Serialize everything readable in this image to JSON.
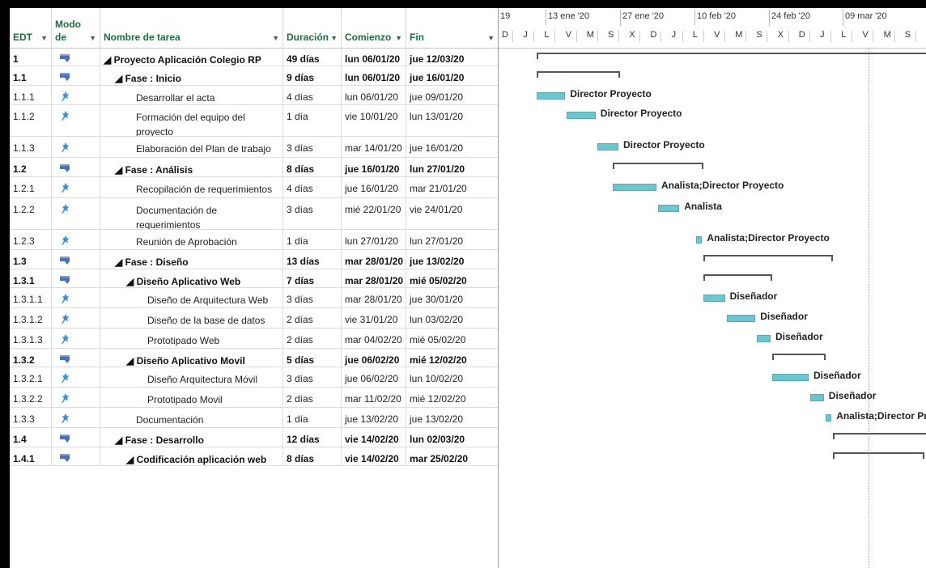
{
  "columns": {
    "edt": "EDT",
    "modo_top": "Modo",
    "modo_bottom": "de",
    "name": "Nombre de tarea",
    "duration": "Duración",
    "start": "Comienzo",
    "end": "Fin"
  },
  "timescale": {
    "weeks": [
      "19",
      "13 ene '20",
      "27 ene '20",
      "10 feb '20",
      "24 feb '20",
      "09 mar '20"
    ],
    "days": [
      "D",
      "J",
      "L",
      "V",
      "M",
      "S",
      "X",
      "D",
      "J",
      "L",
      "V",
      "M",
      "S",
      "X",
      "D",
      "J",
      "L",
      "V",
      "M",
      "S"
    ]
  },
  "colors": {
    "bar": "#6cc6d0",
    "summary": "#555555",
    "header_text": "#1c6e3a"
  },
  "tasks": [
    {
      "edt": "1",
      "mode": "auto",
      "name": "◢ Proyecto Aplicación Colegio RP",
      "duration": "49 días",
      "start": "lun 06/01/20",
      "end": "jue 12/03/20",
      "summary": true,
      "level": 0,
      "resource": ""
    },
    {
      "edt": "1.1",
      "mode": "auto",
      "name": "◢ Fase : Inicio",
      "duration": "9 días",
      "start": "lun 06/01/20",
      "end": "jue 16/01/20",
      "summary": true,
      "level": 1,
      "resource": ""
    },
    {
      "edt": "1.1.1",
      "mode": "manual",
      "name": "Desarrollar el acta",
      "duration": "4 días",
      "start": "lun 06/01/20",
      "end": "jue 09/01/20",
      "summary": false,
      "level": 2,
      "resource": "Director Proyecto"
    },
    {
      "edt": "1.1.2",
      "mode": "manual",
      "name": "Formación del equipo del proyecto",
      "duration": "1 día",
      "start": "vie 10/01/20",
      "end": "lun 13/01/20",
      "summary": false,
      "level": 2,
      "resource": "Director Proyecto"
    },
    {
      "edt": "1.1.3",
      "mode": "manual",
      "name": "Elaboración del Plan de trabajo",
      "duration": "3 días",
      "start": "mar 14/01/20",
      "end": "jue 16/01/20",
      "summary": false,
      "level": 2,
      "resource": "Director Proyecto"
    },
    {
      "edt": "1.2",
      "mode": "auto",
      "name": "◢ Fase : Análisis",
      "duration": "8 días",
      "start": "jue 16/01/20",
      "end": "lun 27/01/20",
      "summary": true,
      "level": 1,
      "resource": ""
    },
    {
      "edt": "1.2.1",
      "mode": "manual",
      "name": "Recopilación de requerimientos",
      "duration": "4 días",
      "start": "jue 16/01/20",
      "end": "mar 21/01/20",
      "summary": false,
      "level": 2,
      "resource": "Analista;Director Proyecto"
    },
    {
      "edt": "1.2.2",
      "mode": "manual",
      "name": "Documentación de requerimientos",
      "duration": "3 días",
      "start": "mié 22/01/20",
      "end": "vie 24/01/20",
      "summary": false,
      "level": 2,
      "resource": "Analista"
    },
    {
      "edt": "1.2.3",
      "mode": "manual",
      "name": "Reunión de  Aprobación",
      "duration": "1 día",
      "start": "lun 27/01/20",
      "end": "lun 27/01/20",
      "summary": false,
      "level": 2,
      "resource": "Analista;Director Proyecto"
    },
    {
      "edt": "1.3",
      "mode": "auto",
      "name": "◢ Fase : Diseño",
      "duration": "13 días",
      "start": "mar 28/01/20",
      "end": "jue 13/02/20",
      "summary": true,
      "level": 1,
      "resource": ""
    },
    {
      "edt": "1.3.1",
      "mode": "auto",
      "name": "◢ Diseño Aplicativo Web",
      "duration": "7 días",
      "start": "mar 28/01/20",
      "end": "mié 05/02/20",
      "summary": true,
      "level": 2,
      "resource": ""
    },
    {
      "edt": "1.3.1.1",
      "mode": "manual",
      "name": "Diseño de  Arquitectura Web",
      "duration": "3 días",
      "start": "mar 28/01/20",
      "end": "jue 30/01/20",
      "summary": false,
      "level": 3,
      "resource": "Diseñador"
    },
    {
      "edt": "1.3.1.2",
      "mode": "manual",
      "name": "Diseño de la base de datos",
      "duration": "2 días",
      "start": "vie 31/01/20",
      "end": "lun 03/02/20",
      "summary": false,
      "level": 3,
      "resource": "Diseñador"
    },
    {
      "edt": "1.3.1.3",
      "mode": "manual",
      "name": "Prototipado Web",
      "duration": "2 días",
      "start": "mar 04/02/20",
      "end": "mié 05/02/20",
      "summary": false,
      "level": 3,
      "resource": "Diseñador"
    },
    {
      "edt": "1.3.2",
      "mode": "auto",
      "name": "◢ Diseño Aplicativo Movil",
      "duration": "5 días",
      "start": "jue 06/02/20",
      "end": "mié 12/02/20",
      "summary": true,
      "level": 2,
      "resource": ""
    },
    {
      "edt": "1.3.2.1",
      "mode": "manual",
      "name": "Diseño Arquitectura Móvil",
      "duration": "3 días",
      "start": "jue 06/02/20",
      "end": "lun 10/02/20",
      "summary": false,
      "level": 3,
      "resource": "Diseñador"
    },
    {
      "edt": "1.3.2.2",
      "mode": "manual",
      "name": "Prototipado Movil",
      "duration": "2 días",
      "start": "mar 11/02/20",
      "end": "mié 12/02/20",
      "summary": false,
      "level": 3,
      "resource": "Diseñador"
    },
    {
      "edt": "1.3.3",
      "mode": "manual",
      "name": "Documentación",
      "duration": "1 día",
      "start": "jue 13/02/20",
      "end": "jue 13/02/20",
      "summary": false,
      "level": 2,
      "resource": "Analista;Director Proyecto"
    },
    {
      "edt": "1.4",
      "mode": "auto",
      "name": "◢ Fase : Desarrollo",
      "duration": "12 días",
      "start": "vie 14/02/20",
      "end": "lun 02/03/20",
      "summary": true,
      "level": 1,
      "resource": ""
    },
    {
      "edt": "1.4.1",
      "mode": "auto",
      "name": "◢ Codificación aplicación web",
      "duration": "8 días",
      "start": "vie 14/02/20",
      "end": "mar 25/02/20",
      "summary": true,
      "level": 2,
      "resource": ""
    }
  ]
}
